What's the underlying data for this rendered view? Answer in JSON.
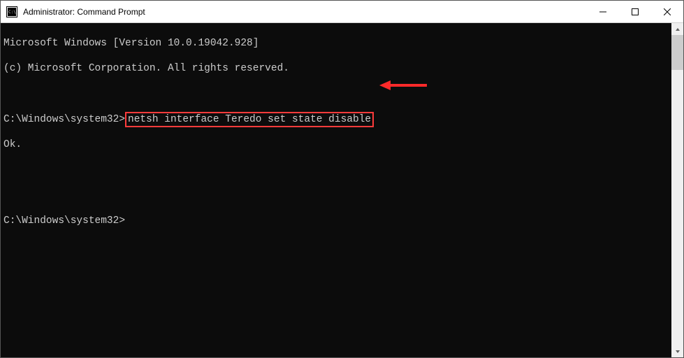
{
  "window": {
    "title": "Administrator: Command Prompt"
  },
  "terminal": {
    "line1": "Microsoft Windows [Version 10.0.19042.928]",
    "line2": "(c) Microsoft Corporation. All rights reserved.",
    "prompt1_prefix": "C:\\Windows\\system32>",
    "prompt1_command": "netsh interface Teredo set state disable",
    "response": "Ok.",
    "prompt2": "C:\\Windows\\system32>"
  },
  "annotation": {
    "highlight_color": "#ff3b3b",
    "arrow_color": "#ff2a2a"
  }
}
